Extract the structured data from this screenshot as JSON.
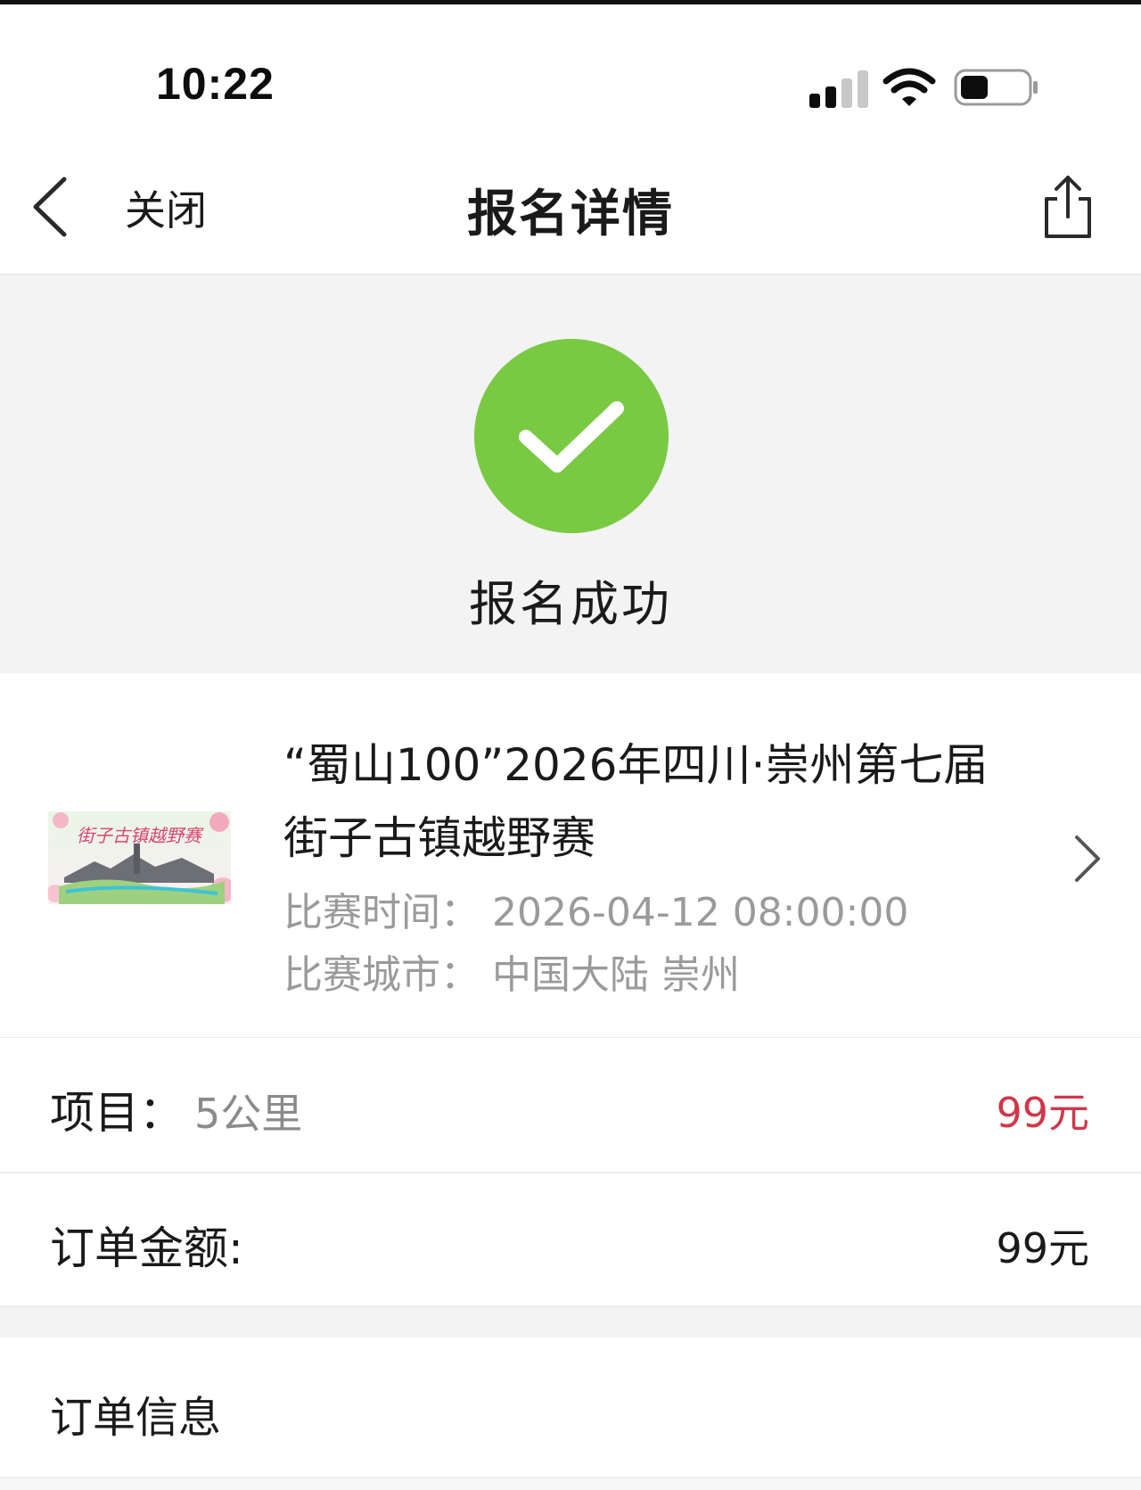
{
  "status_bar": {
    "time": "10:22"
  },
  "nav": {
    "close_label": "关闭",
    "title": "报名详情"
  },
  "success": {
    "text": "报名成功",
    "color": "#7ac943"
  },
  "event": {
    "title_line1": "“蜀山100”2026年四川·崇州第七届",
    "title_line2": "街子古镇越野赛",
    "time_label": "比赛时间：",
    "time_value": "2026-04-12 08:00:00",
    "city_label": "比赛城市：",
    "city_value": "中国大陆 崇州",
    "poster_text": "街子古镇越野赛"
  },
  "item_row": {
    "label": "项目：",
    "value": "5公里",
    "price": "99元"
  },
  "amount_row": {
    "label": "订单金额:",
    "value": "99元"
  },
  "order_info": {
    "label": "订单信息"
  },
  "colors": {
    "price_red": "#d0374a",
    "success_green": "#7ac943",
    "muted_gray": "#9a9a9a"
  }
}
